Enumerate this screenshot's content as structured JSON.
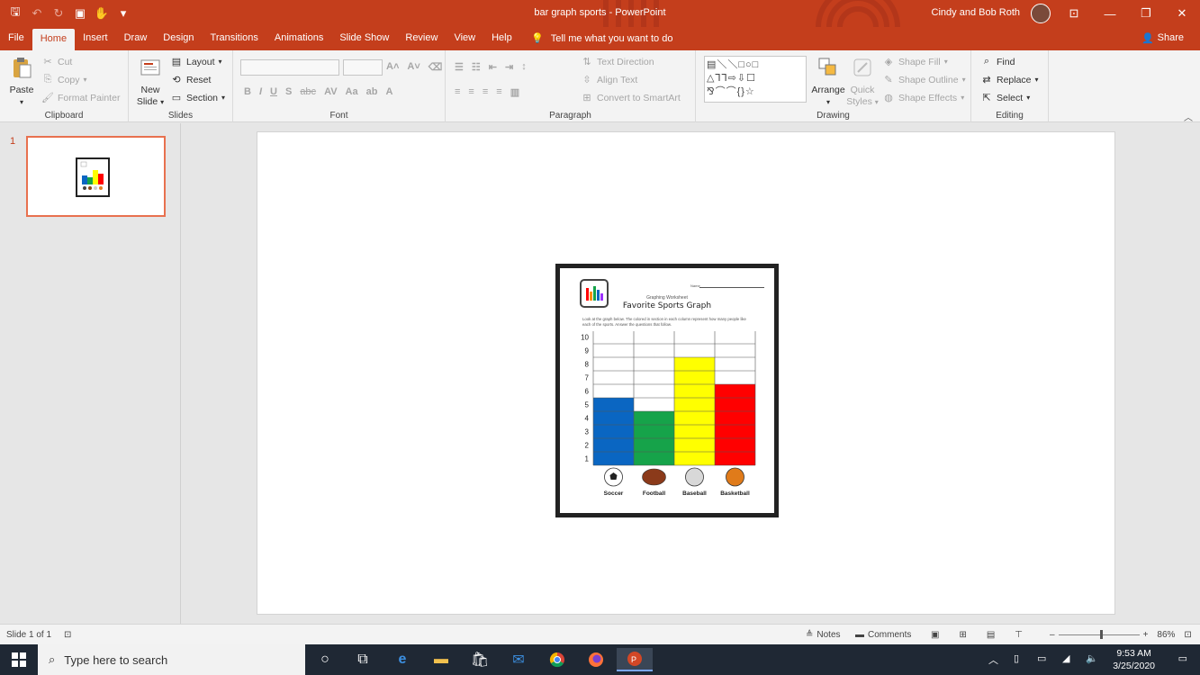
{
  "window": {
    "title": "bar graph sports  -  PowerPoint",
    "user": "Cindy and Bob Roth"
  },
  "tabs": [
    "File",
    "Home",
    "Insert",
    "Draw",
    "Design",
    "Transitions",
    "Animations",
    "Slide Show",
    "Review",
    "View",
    "Help"
  ],
  "tell_me": "Tell me what you want to do",
  "share": "Share",
  "ribbon": {
    "clipboard": {
      "label": "Clipboard",
      "paste": "Paste",
      "cut": "Cut",
      "copy": "Copy",
      "format_painter": "Format Painter"
    },
    "slides": {
      "label": "Slides",
      "new_slide_1": "New",
      "new_slide_2": "Slide",
      "layout": "Layout",
      "reset": "Reset",
      "section": "Section"
    },
    "font": {
      "label": "Font"
    },
    "paragraph": {
      "label": "Paragraph",
      "text_direction": "Text Direction",
      "align_text": "Align Text",
      "convert_smartart": "Convert to SmartArt"
    },
    "drawing": {
      "label": "Drawing",
      "arrange": "Arrange",
      "quick_styles_1": "Quick",
      "quick_styles_2": "Styles",
      "shape_fill": "Shape Fill",
      "shape_outline": "Shape Outline",
      "shape_effects": "Shape Effects"
    },
    "editing": {
      "label": "Editing",
      "find": "Find",
      "replace": "Replace",
      "select": "Select"
    }
  },
  "thumbnail": {
    "number": "1"
  },
  "worksheet": {
    "name_label": "Name",
    "subtitle": "Graphing Worksheet",
    "title": "Favorite Sports Graph",
    "instructions": "Look at the graph below.  The colored in section in each column represent how many people like each of the sports.  Answer the questions that follow."
  },
  "chart_data": {
    "type": "bar",
    "categories": [
      "Soccer",
      "Football",
      "Baseball",
      "Basketball"
    ],
    "values": [
      5,
      4,
      8,
      6
    ],
    "colors": [
      "#0a66c2",
      "#16a34a",
      "#ffff00",
      "#ff0000"
    ],
    "ylim": [
      0,
      10
    ],
    "yticks": [
      "1",
      "2",
      "3",
      "4",
      "5",
      "6",
      "7",
      "8",
      "9",
      "10"
    ],
    "grid": true
  },
  "status": {
    "slide_info": "Slide 1 of 1",
    "notes": "Notes",
    "comments": "Comments",
    "zoom": "86%"
  },
  "taskbar": {
    "search_placeholder": "Type here to search",
    "time": "9:53 AM",
    "date": "3/25/2020"
  }
}
